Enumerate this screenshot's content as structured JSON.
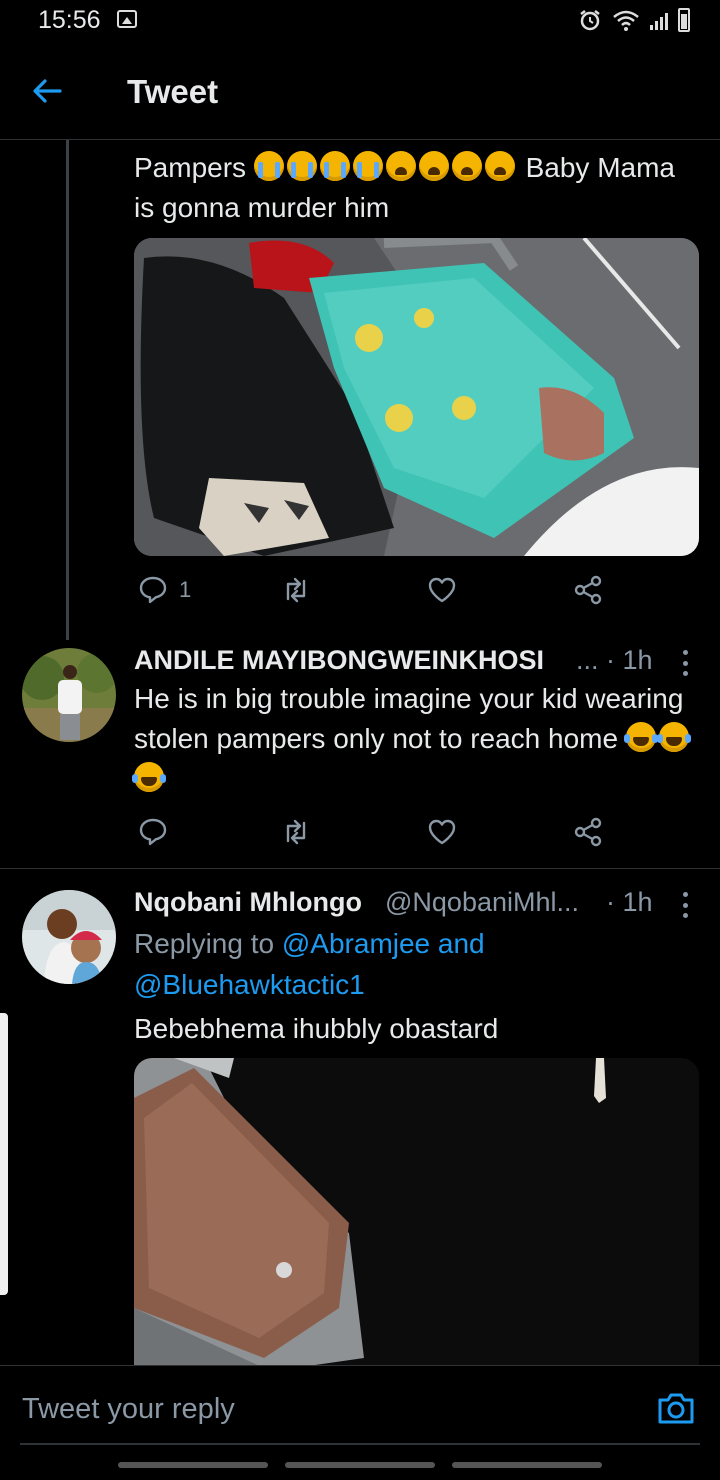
{
  "status_bar": {
    "time": "15:56",
    "icons": [
      "gallery-icon",
      "alarm-icon",
      "wifi-icon",
      "signal-icon",
      "battery-icon"
    ]
  },
  "header": {
    "title": "Tweet"
  },
  "tweet_1": {
    "text_before": "Pampers",
    "emojis": [
      "loudly-crying-face",
      "loudly-crying-face",
      "loudly-crying-face",
      "loudly-crying-face",
      "weary-face",
      "weary-face",
      "weary-face",
      "weary-face"
    ],
    "text_after": "Baby Mama is gonna murder him",
    "media_icon": "photo-of-pampers-pack-icon",
    "reply_count": "1"
  },
  "tweet_2": {
    "name": "ANDILE MAYIBONGWEINKHOSI",
    "ellipsis": "...",
    "time": "· 1h",
    "text": "He is in big trouble imagine your kid wearing stolen pampers only not to reach home",
    "emojis": [
      "face-with-tears-of-joy",
      "face-with-tears-of-joy",
      "face-with-tears-of-joy"
    ]
  },
  "tweet_3": {
    "name": "Nqobani Mhlongo",
    "handle": "@NqobaniMhl...",
    "time": "· 1h",
    "replying_prefix": "Replying to",
    "replying_to_1": "@Abramjee and",
    "replying_to_2": "@Bluehawktactic1",
    "text": "Bebebhema ihubbly obastard",
    "media_icon": "photo-of-pistol-icon"
  },
  "reply_bar": {
    "placeholder": "Tweet your reply"
  },
  "colors": {
    "background": "#000000",
    "accent": "#1d9bf0",
    "text": "#e7e9ea",
    "muted": "#8b98a5",
    "divider": "#2f3336"
  }
}
